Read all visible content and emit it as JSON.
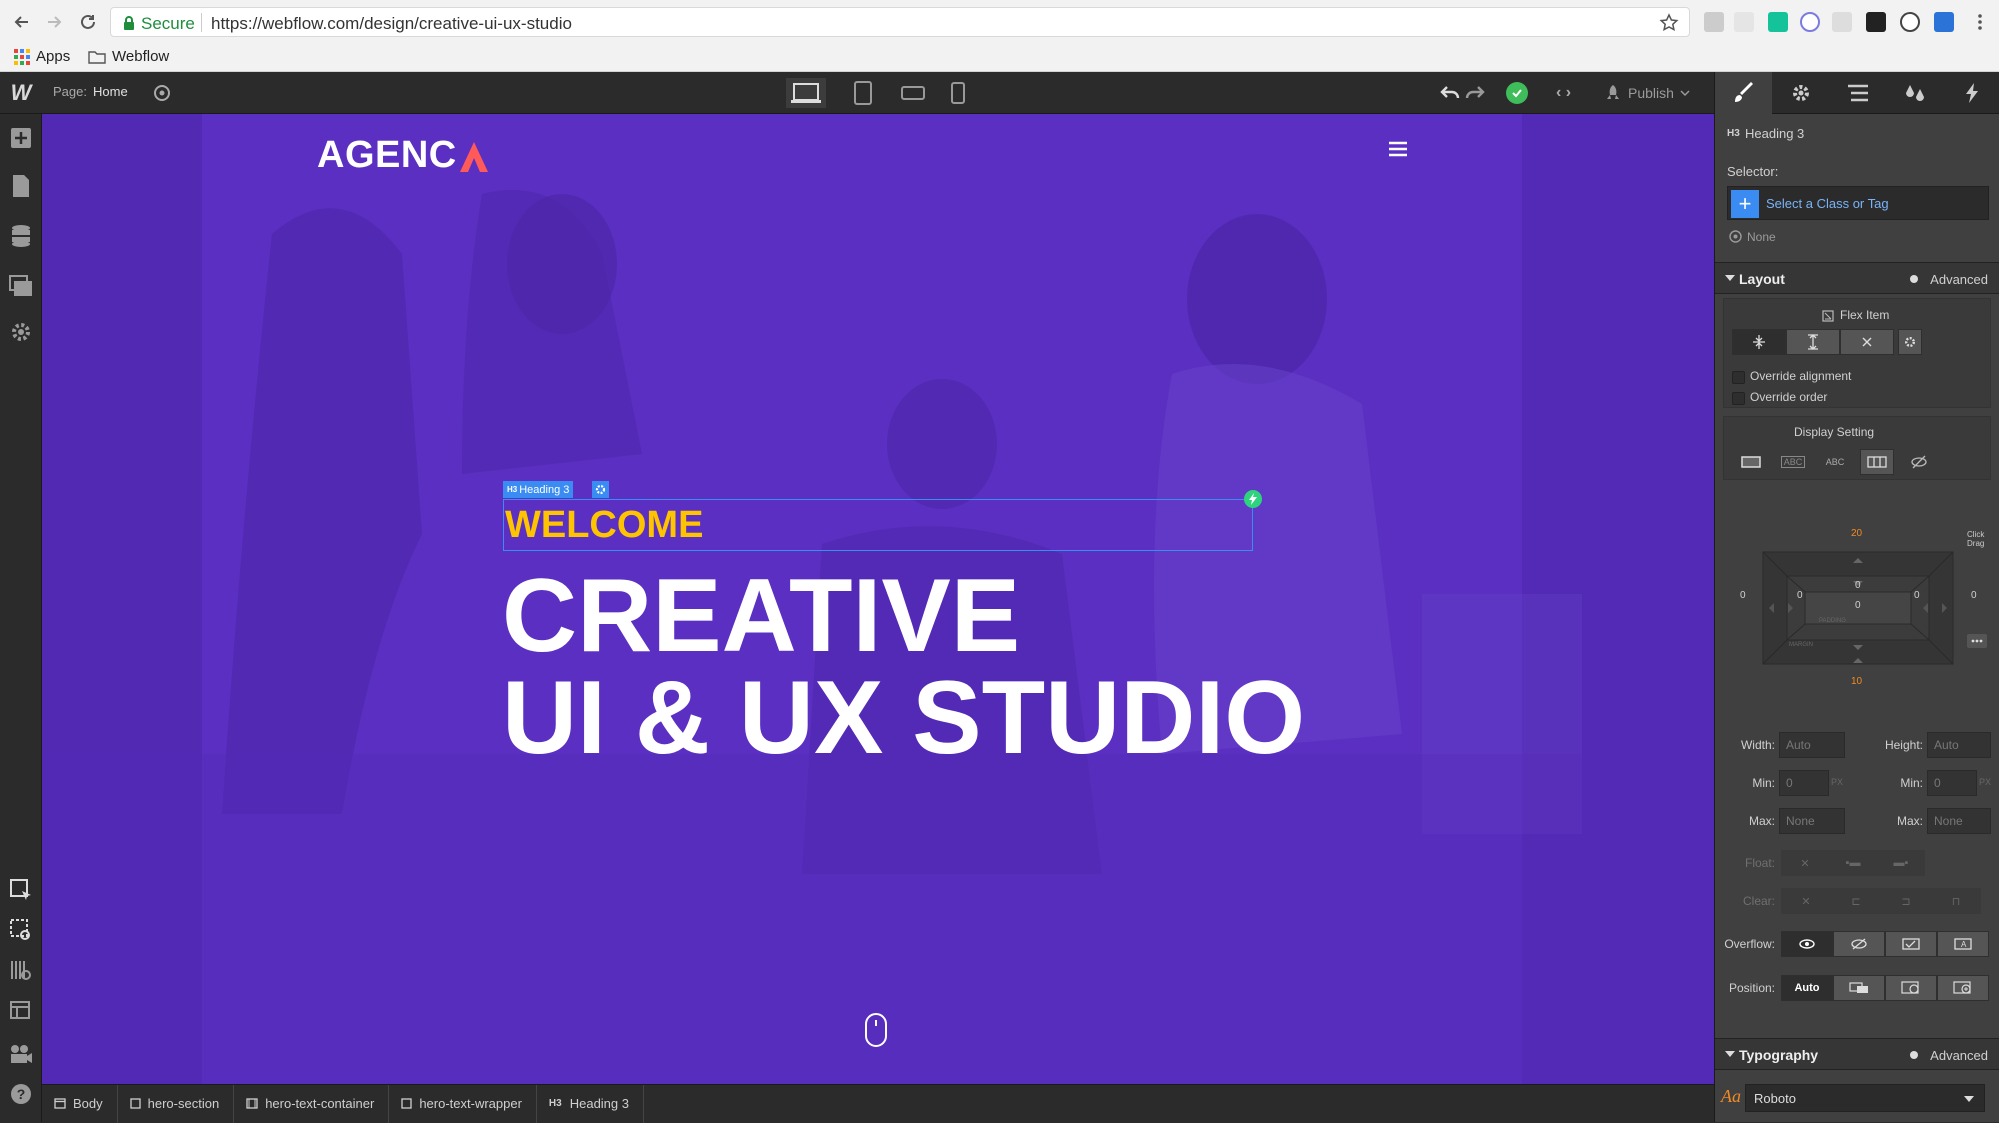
{
  "browser": {
    "secure_label": "Secure",
    "url": "https://webflow.com/design/creative-ui-ux-studio",
    "bookmarks": [
      "Apps",
      "Webflow"
    ]
  },
  "topbar": {
    "page_label": "Page:",
    "page_name": "Home",
    "publish_label": "Publish"
  },
  "canvas": {
    "logo_text": "AGENC",
    "selected_badge_tag": "H3",
    "selected_badge_label": "Heading 3",
    "welcome": "WELCOME",
    "hero_line1": "CREATIVE",
    "hero_line2": "UI & UX STUDIO",
    "colors": {
      "background": "#5a2fc2",
      "accent": "#ffc400",
      "selection": "#3a8cf2"
    }
  },
  "breadcrumb": [
    {
      "label": "Body"
    },
    {
      "label": "hero-section"
    },
    {
      "label": "hero-text-container"
    },
    {
      "label": "hero-text-wrapper"
    },
    {
      "label": "Heading 3",
      "tag": "H3"
    }
  ],
  "panel": {
    "element_tag": "H3",
    "element_name": "Heading 3",
    "selector_label": "Selector:",
    "selector_placeholder": "Select a Class or Tag",
    "none_label": "None",
    "layout": {
      "title": "Layout",
      "advanced": "Advanced",
      "flex_item_label": "Flex Item",
      "override_alignment": "Override alignment",
      "override_order": "Override order",
      "display_setting": "Display Setting",
      "display_options": [
        "ABC",
        "ABC"
      ]
    },
    "box_model": {
      "margin_top": "20",
      "margin_bottom": "10",
      "margin_left": "0",
      "margin_right": "0",
      "padding_top": "0",
      "padding_bottom": "0",
      "padding_left": "0",
      "padding_right": "0",
      "padding_label": "PADDING",
      "margin_label": "MARGIN",
      "hint": "Click\nDrag"
    },
    "sizing": {
      "width_label": "Width:",
      "width_value": "Auto",
      "height_label": "Height:",
      "height_value": "Auto",
      "min_label": "Min:",
      "min_width": "0",
      "min_height": "0",
      "unit": "PX",
      "max_label": "Max:",
      "max_width": "None",
      "max_height": "None"
    },
    "float_label": "Float:",
    "clear_label": "Clear:",
    "overflow_label": "Overflow:",
    "position_label": "Position:",
    "position_value": "Auto",
    "typography": {
      "title": "Typography",
      "advanced": "Advanced",
      "font_icon_label": "Aa",
      "font_value": "Roboto"
    }
  }
}
